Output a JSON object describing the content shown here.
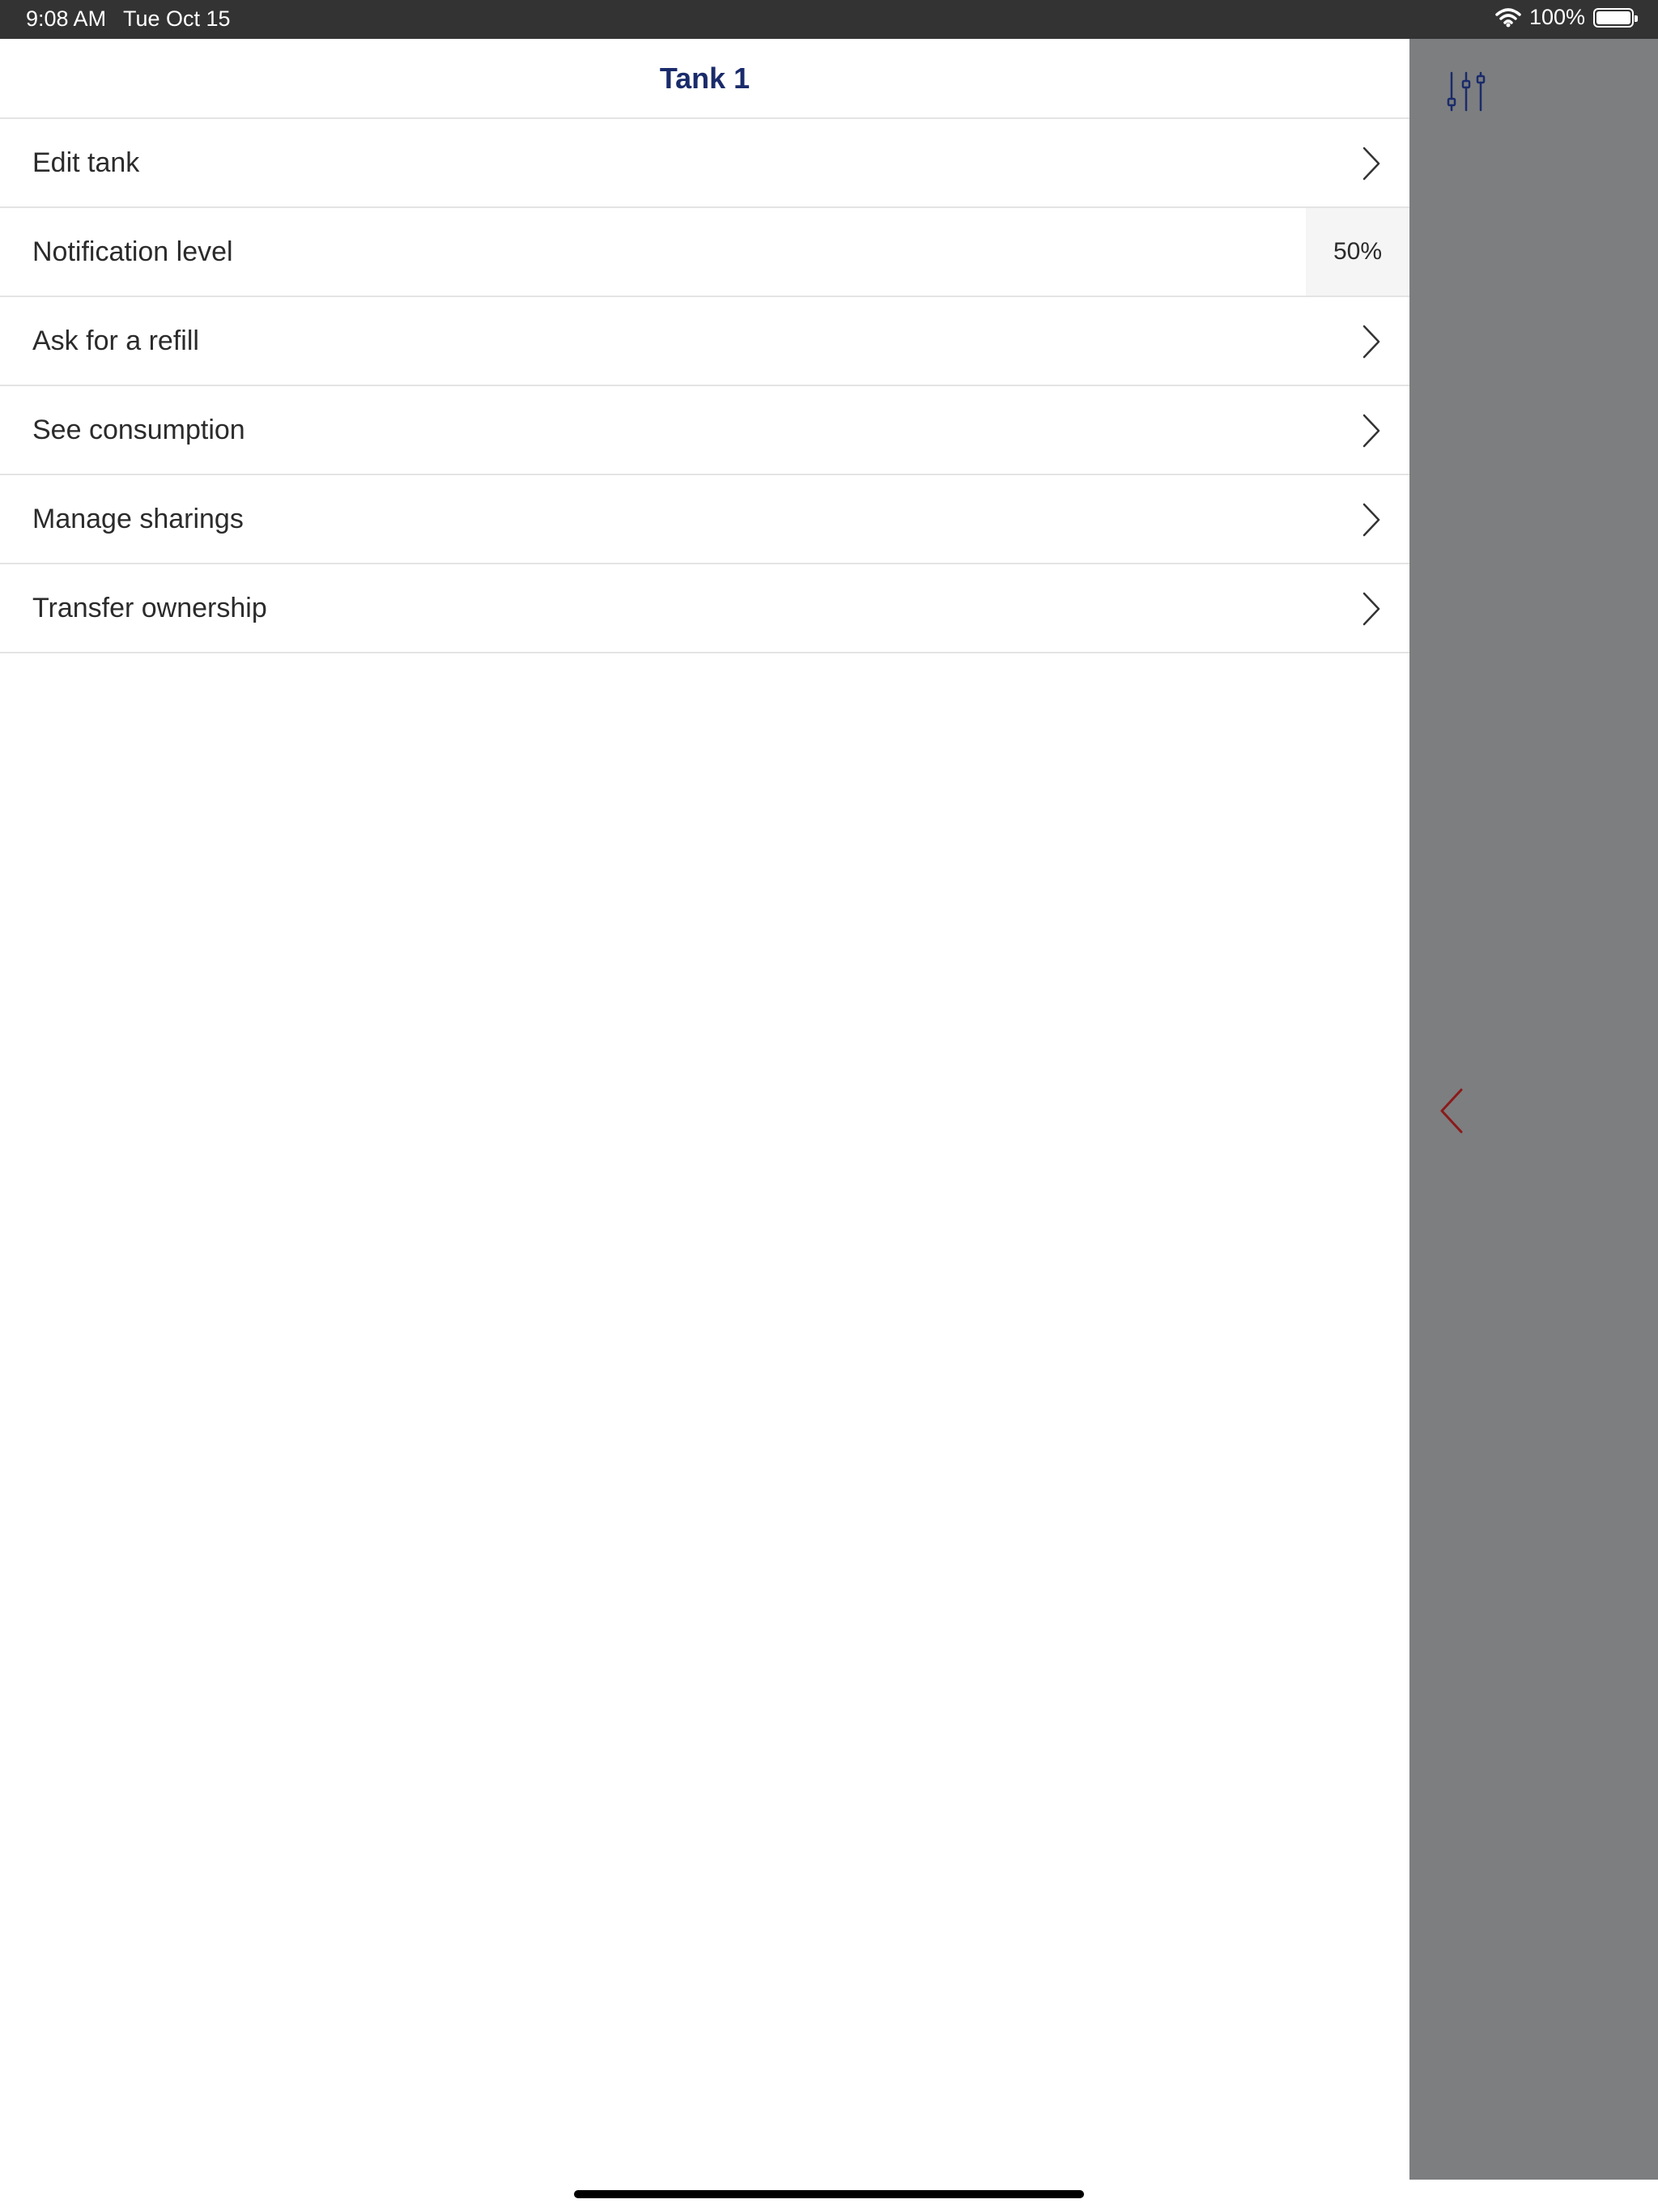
{
  "status_bar": {
    "time": "9:08 AM",
    "date": "Tue Oct 15",
    "battery_text": "100%",
    "icons": [
      "wifi-icon",
      "battery-icon"
    ]
  },
  "header": {
    "title": "Tank 1"
  },
  "menu": {
    "items": [
      {
        "label": "Edit tank",
        "icon": "chevron-right-icon"
      },
      {
        "label": "Notification level",
        "value": "50%"
      },
      {
        "label": "Ask for a refill",
        "icon": "chevron-right-icon"
      },
      {
        "label": "See consumption",
        "icon": "chevron-right-icon"
      },
      {
        "label": "Manage sharings",
        "icon": "chevron-right-icon"
      },
      {
        "label": "Transfer ownership",
        "icon": "chevron-right-icon"
      }
    ]
  },
  "side_panel": {
    "icons": [
      "filter-sliders-icon",
      "chevron-left-icon"
    ]
  },
  "colors": {
    "title": "#1a2b6b",
    "overlay": "#7d7e80",
    "filter_icon": "#1a2b6b",
    "back_chevron": "#8b1a1a",
    "status_bar": "#333333"
  }
}
